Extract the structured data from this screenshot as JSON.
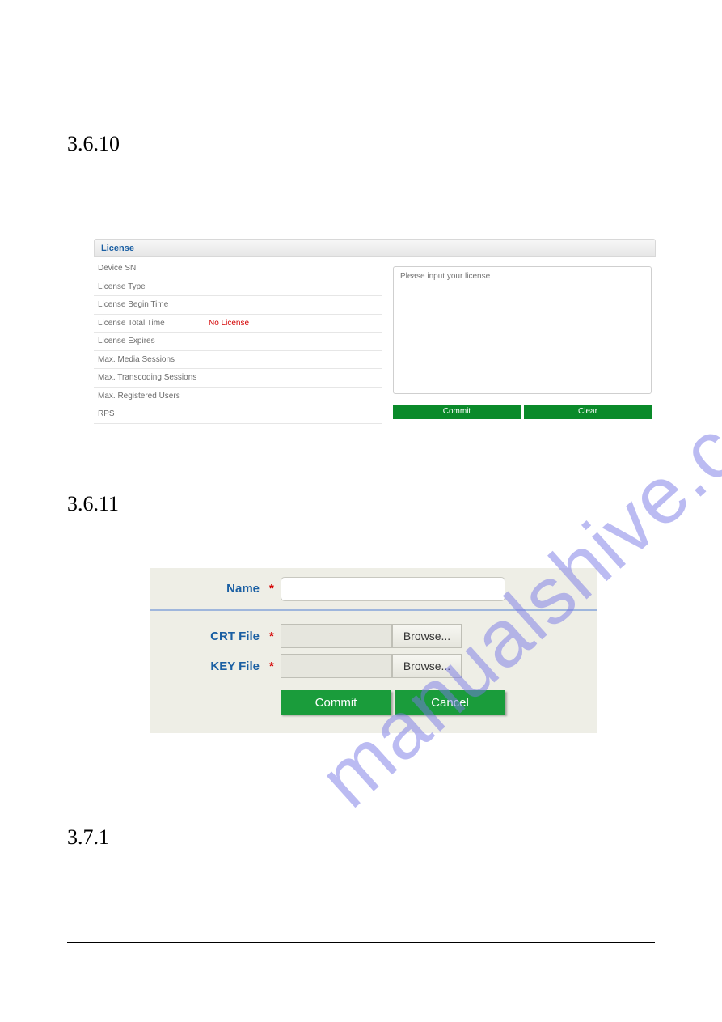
{
  "sections": {
    "s1": "3.6.10",
    "s2": "3.6.11",
    "s3": "3.7.1"
  },
  "watermark": "manualshive.com",
  "license_panel": {
    "title": "License",
    "rows": {
      "device_sn": {
        "label": "Device SN",
        "value": ""
      },
      "license_type": {
        "label": "License Type",
        "value": ""
      },
      "license_begin_time": {
        "label": "License Begin Time",
        "value": ""
      },
      "license_total_time": {
        "label": "License Total Time",
        "value": "No License"
      },
      "license_expires": {
        "label": "License Expires",
        "value": ""
      },
      "max_media_sessions": {
        "label": "Max. Media Sessions",
        "value": ""
      },
      "max_transcoding_sessions": {
        "label": "Max. Transcoding Sessions",
        "value": ""
      },
      "max_registered_users": {
        "label": "Max. Registered Users",
        "value": ""
      },
      "rps": {
        "label": "RPS",
        "value": ""
      }
    },
    "textarea_placeholder": "Please input your license",
    "buttons": {
      "commit": "Commit",
      "clear": "Clear"
    }
  },
  "cert_form": {
    "labels": {
      "name": "Name",
      "crt_file": "CRT File",
      "key_file": "KEY File"
    },
    "asterisk": "*",
    "browse": "Browse...",
    "buttons": {
      "commit": "Commit",
      "cancel": "Cancel"
    }
  }
}
